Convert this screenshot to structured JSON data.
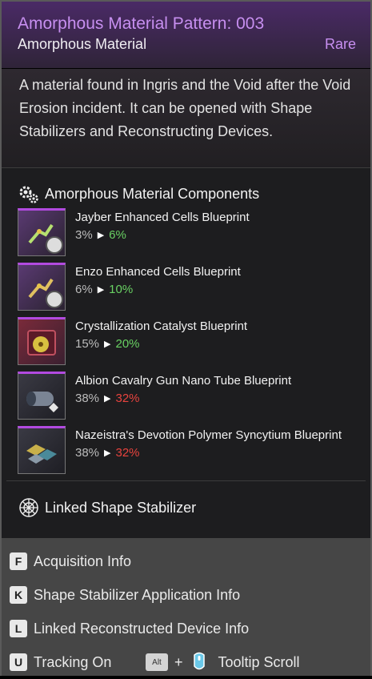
{
  "header": {
    "title": "Amorphous Material Pattern: 003",
    "subtitle": "Amorphous Material",
    "rarity": "Rare"
  },
  "description": "A material found in Ingris and the Void after the Void Erosion incident. It can be opened with Shape Stabilizers and Reconstructing Devices.",
  "components": {
    "title": "Amorphous Material Components",
    "icon": "gears-icon",
    "items": [
      {
        "name": "Jayber Enhanced Cells Blueprint",
        "from": "3%",
        "to": "6%",
        "trend": "up"
      },
      {
        "name": "Enzo Enhanced Cells Blueprint",
        "from": "6%",
        "to": "10%",
        "trend": "up"
      },
      {
        "name": "Crystallization Catalyst Blueprint",
        "from": "15%",
        "to": "20%",
        "trend": "up"
      },
      {
        "name": "Albion Cavalry Gun Nano Tube Blueprint",
        "from": "38%",
        "to": "32%",
        "trend": "down"
      },
      {
        "name": "Nazeistra's Devotion Polymer Syncytium Blueprint",
        "from": "38%",
        "to": "32%",
        "trend": "down"
      }
    ]
  },
  "linked": {
    "title": "Linked Shape Stabilizer",
    "icon": "web-icon"
  },
  "footer": {
    "rows": [
      {
        "key": "F",
        "label": "Acquisition Info"
      },
      {
        "key": "K",
        "label": "Shape Stabilizer Application Info"
      },
      {
        "key": "L",
        "label": "Linked Reconstructed Device Info"
      }
    ],
    "tracking_key": "U",
    "tracking_label": "Tracking On",
    "alt_key": "Alt",
    "plus": "+",
    "scroll_label": "Tooltip Scroll"
  },
  "colors": {
    "rare": "#c78ff0",
    "up": "#69d163",
    "down": "#e8433e"
  }
}
